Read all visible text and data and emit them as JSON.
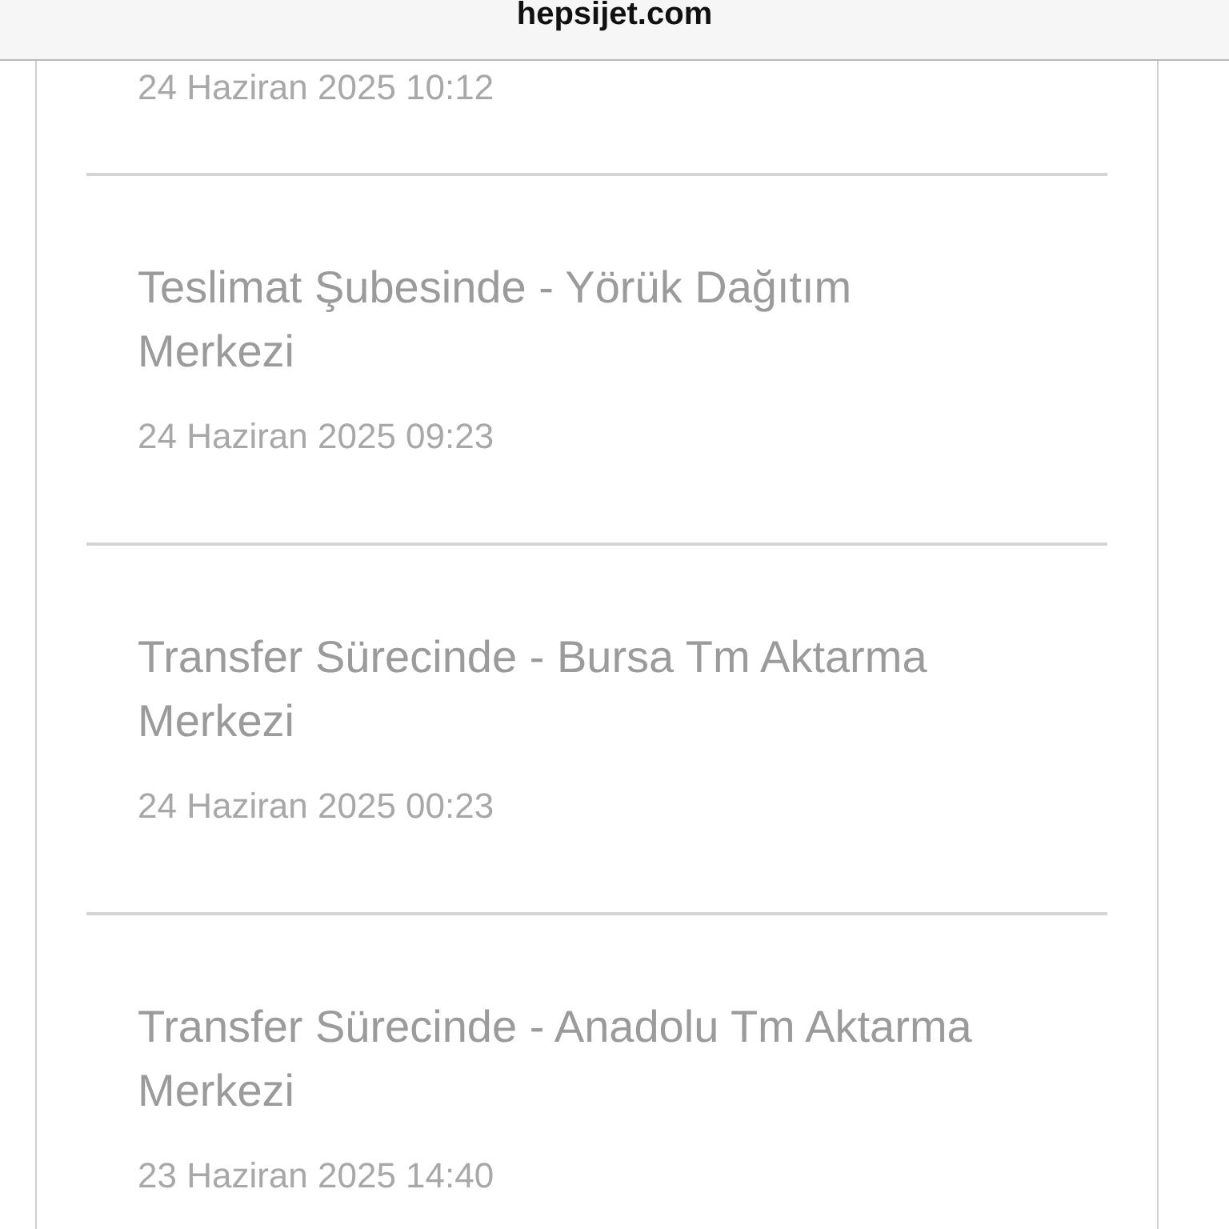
{
  "address_bar": {
    "url": "hepsijet.com"
  },
  "events": [
    {
      "date": "24 Haziran 2025 10:12"
    },
    {
      "title": "Teslimat Şubesinde - Yörük Dağıtım Merkezi",
      "date": "24 Haziran 2025 09:23"
    },
    {
      "title": "Transfer Sürecinde - Bursa Tm Aktarma Merkezi",
      "date": "24 Haziran 2025 00:23"
    },
    {
      "title": "Transfer Sürecinde - Anadolu Tm Aktarma Merkezi",
      "date": "23 Haziran 2025 14:40"
    }
  ]
}
